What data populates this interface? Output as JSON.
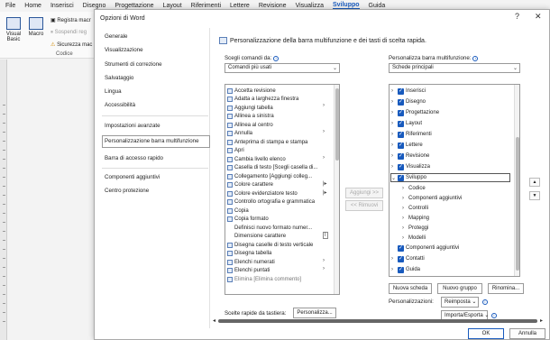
{
  "menubar": {
    "items": [
      "File",
      "Home",
      "Inserisci",
      "Disegno",
      "Progettazione",
      "Layout",
      "Riferimenti",
      "Lettere",
      "Revisione",
      "Visualizza",
      "Sviluppo",
      "Guida"
    ],
    "active": "Sviluppo"
  },
  "ribbon": {
    "visual_basic": "Visual Basic",
    "macro": "Macro",
    "registra_macro": "Registra macr",
    "sospendi": "Sospendi reg",
    "sicurezza": "Sicurezza mac",
    "group_label": "Codice"
  },
  "dialog": {
    "title": "Opzioni di Word",
    "help": "?",
    "close": "✕",
    "nav": {
      "items": [
        "Generale",
        "Visualizzazione",
        "Strumenti di correzione",
        "Salvataggio",
        "Lingua",
        "Accessibilità",
        "Impostazioni avanzate",
        "Personalizzazione barra multifunzione",
        "Barra di accesso rapido",
        "Componenti aggiuntivi",
        "Centro protezione"
      ],
      "selected": "Personalizzazione barra multifunzione"
    },
    "heading": "Personalizzazione della barra multifunzione e dei tasti di scelta rapida.",
    "left_label": "Scegli comandi da:",
    "left_combo": "Comandi più usati",
    "right_label": "Personalizza barra multifunzione:",
    "right_combo": "Schede principali",
    "commands": [
      "Accetta revisione",
      "Adatta a larghezza finestra",
      "Aggiungi tabella",
      "Allinea a sinistra",
      "Allinea al centro",
      "Annulla",
      "Anteprima di stampa e stampa",
      "Apri",
      "Cambia livello elenco",
      "Casella di testo [Scegli casella di...",
      "Collegamento [Aggiungi colleg...",
      "Colore carattere",
      "Colore evidenziatore testo",
      "Controllo ortografia e grammatica",
      "Copia",
      "Copia formato",
      "Definisci nuovo formato numer...",
      "Dimensione carattere",
      "Disegna caselle di testo verticale",
      "Disegna tabella",
      "Elenchi numerati",
      "Elenchi puntati",
      "Elimina [Elimina commento]"
    ],
    "add_button": "Aggiungi >>",
    "remove_button": "<< Rimuovi",
    "tabs_tree": [
      "Inserisci",
      "Disegno",
      "Progettazione",
      "Layout",
      "Riferimenti",
      "Lettere",
      "Revisione",
      "Visualizza",
      "Sviluppo",
      "Codice",
      "Componenti aggiuntivi",
      "Controlli",
      "Mapping",
      "Proteggi",
      "Modelli",
      "Componenti aggiuntivi",
      "Contatti",
      "Guida"
    ],
    "nuova_scheda": "Nuova scheda",
    "nuovo_gruppo": "Nuovo gruppo",
    "rinomina": "Rinomina...",
    "personalizzazioni_label": "Personalizzazioni:",
    "reimposta": "Reimposta",
    "importa_esporta": "Importa/Esporta",
    "scelte_label": "Scelte rapide da tastiera:",
    "personalizza_btn": "Personalizza...",
    "ok": "OK",
    "annulla": "Annulla"
  }
}
